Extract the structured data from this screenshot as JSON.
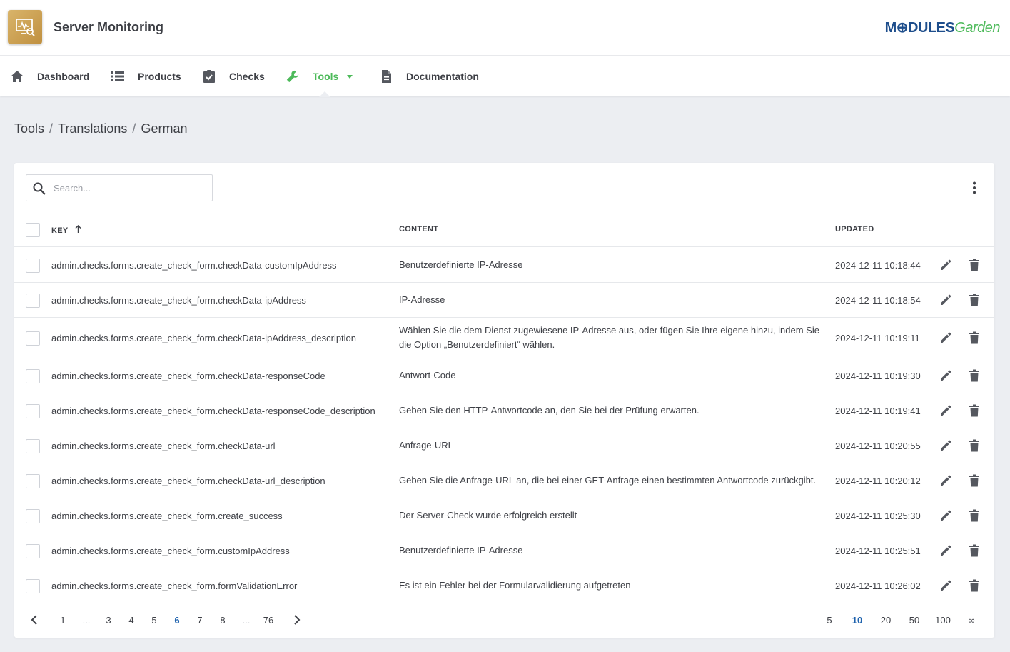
{
  "app": {
    "title": "Server Monitoring",
    "brand_strong": "M⊕DULES",
    "brand_light": "Garden"
  },
  "nav": [
    {
      "label": "Dashboard",
      "icon": "home-icon"
    },
    {
      "label": "Products",
      "icon": "list-icon"
    },
    {
      "label": "Checks",
      "icon": "clipboard-check-icon"
    },
    {
      "label": "Tools",
      "icon": "wrench-icon",
      "active": true
    },
    {
      "label": "Documentation",
      "icon": "document-icon"
    }
  ],
  "breadcrumb": [
    "Tools",
    "Translations",
    "German"
  ],
  "search": {
    "placeholder": "Search...",
    "value": ""
  },
  "table": {
    "headers": {
      "key": "KEY",
      "content": "CONTENT",
      "updated": "UPDATED"
    },
    "sort": {
      "column": "key",
      "direction": "asc"
    },
    "rows": [
      {
        "key": "admin.checks.forms.create_check_form.checkData-customIpAddress",
        "content": "Benutzerdefinierte IP-Adresse",
        "updated": "2024-12-11 10:18:44"
      },
      {
        "key": "admin.checks.forms.create_check_form.checkData-ipAddress",
        "content": "IP-Adresse",
        "updated": "2024-12-11 10:18:54"
      },
      {
        "key": "admin.checks.forms.create_check_form.checkData-ipAddress_description",
        "content": "Wählen Sie die dem Dienst zugewiesene IP-Adresse aus, oder fügen Sie Ihre eigene hinzu, indem Sie die Option „Benutzerdefiniert“ wählen.",
        "updated": "2024-12-11 10:19:11"
      },
      {
        "key": "admin.checks.forms.create_check_form.checkData-responseCode",
        "content": "Antwort-Code",
        "updated": "2024-12-11 10:19:30"
      },
      {
        "key": "admin.checks.forms.create_check_form.checkData-responseCode_description",
        "content": "Geben Sie den HTTP-Antwortcode an, den Sie bei der Prüfung erwarten.",
        "updated": "2024-12-11 10:19:41"
      },
      {
        "key": "admin.checks.forms.create_check_form.checkData-url",
        "content": "Anfrage-URL",
        "updated": "2024-12-11 10:20:55"
      },
      {
        "key": "admin.checks.forms.create_check_form.checkData-url_description",
        "content": "Geben Sie die Anfrage-URL an, die bei einer GET-Anfrage einen bestimmten Antwortcode zurückgibt.",
        "updated": "2024-12-11 10:20:12"
      },
      {
        "key": "admin.checks.forms.create_check_form.create_success",
        "content": "Der Server-Check wurde erfolgreich erstellt",
        "updated": "2024-12-11 10:25:30"
      },
      {
        "key": "admin.checks.forms.create_check_form.customIpAddress",
        "content": "Benutzerdefinierte IP-Adresse",
        "updated": "2024-12-11 10:25:51"
      },
      {
        "key": "admin.checks.forms.create_check_form.formValidationError",
        "content": "Es ist ein Fehler bei der Formularvalidierung aufgetreten",
        "updated": "2024-12-11 10:26:02"
      }
    ]
  },
  "pagination": {
    "pages": [
      "1",
      "...",
      "3",
      "4",
      "5",
      "6",
      "7",
      "8",
      "...",
      "76"
    ],
    "current": "6",
    "page_sizes": [
      "5",
      "10",
      "20",
      "50",
      "100",
      "∞"
    ],
    "current_size": "10"
  },
  "colors": {
    "accent": "#4dba5a",
    "brand_blue": "#1e4e8c",
    "link_blue": "#1e62ad"
  }
}
